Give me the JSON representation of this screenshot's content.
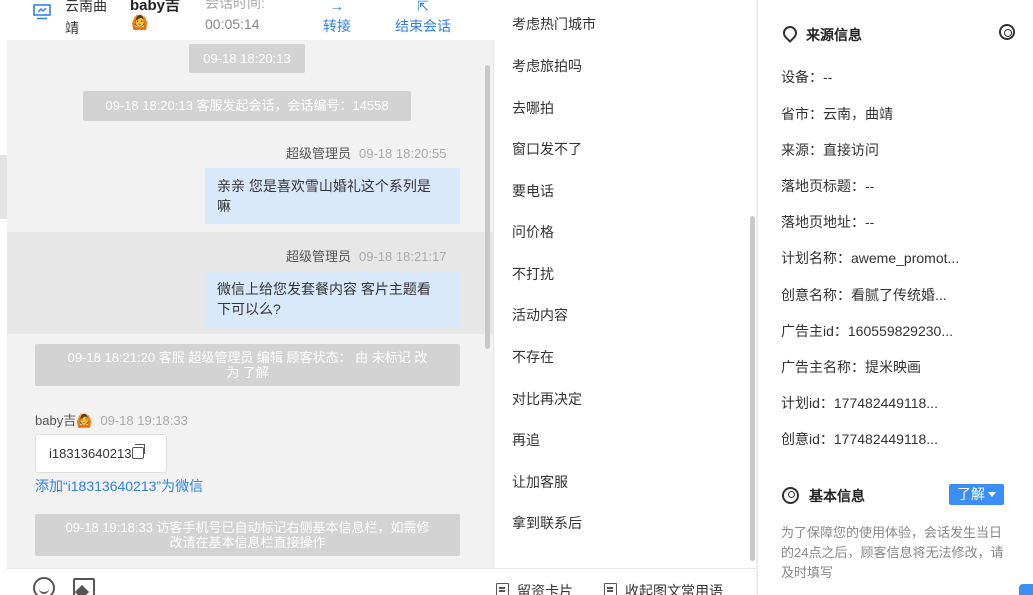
{
  "header": {
    "location": "云南曲靖",
    "username": "baby吉",
    "user_emoji": "🙆",
    "session_time_label": "会话时间:",
    "session_time": "00:05:14",
    "transfer_label": "转接",
    "end_label": "结束会话"
  },
  "chat": {
    "date_pill": "09-18 18:20:13",
    "session_start": "09-18 18:20:13 客服发起会话，会话编号：14558",
    "messages": [
      {
        "sender": "超级管理员",
        "time": "09-18 18:20:55",
        "text1": "亲亲 您是喜欢雪山婚礼这个系列是",
        "text2": "嘛"
      },
      {
        "sender": "超级管理员",
        "time": "09-18 18:21:17",
        "text1": "微信上给您发套餐内容 客片主题看",
        "text2": "下可以么?"
      }
    ],
    "edit_notice_line1": "09-18 18:21:20 客服 超级管理员 编辑 顾客状态： 由 未标记 改",
    "edit_notice_line2": "为 了解",
    "visitor_name": "baby吉",
    "visitor_emoji": "🙆",
    "visitor_time": "09-18 19:18:33",
    "visitor_code": "i18313640213",
    "add_wechat_link": "添加“i18313640213”为微信",
    "auto_notice_line1": "09-18 19:18:33 访客手机号已自动标记右侧基本信息栏，如需修",
    "auto_notice_line2": "改请在基本信息栏直接操作"
  },
  "quick_replies": [
    "考虑热门城市",
    "考虑旅拍吗",
    "去哪拍",
    "窗口发不了",
    "要电话",
    "问价格",
    "不打扰",
    "活动内容",
    "不存在",
    "对比再决定",
    "再追",
    "让加客服",
    "拿到联系后"
  ],
  "quick_footer": {
    "card_label": "留资卡片",
    "collapse_label": "收起图文常用语"
  },
  "info": {
    "source_title": "来源信息",
    "fields": [
      "设备：--",
      "省市：云南，曲靖",
      "来源：直接访问",
      "落地页标题：--",
      "落地页地址：--",
      "计划名称：aweme_promot...",
      "创意名称：看腻了传统婚...",
      "广告主id：160559829230...",
      "广告主名称：提米映画",
      "计划id：177482449118...",
      "创意id：177482449118..."
    ],
    "basic_title": "基本信息",
    "status_badge": "了解",
    "notice": "为了保障您的使用体验，会话发生当日的24点之后，顾客信息将无法修改，请及时填写"
  },
  "colors": {
    "accent": "#2f80ed",
    "bubble": "#dae8fc",
    "system_pill": "#d3d3d3",
    "badge": "#3a8ef6"
  }
}
